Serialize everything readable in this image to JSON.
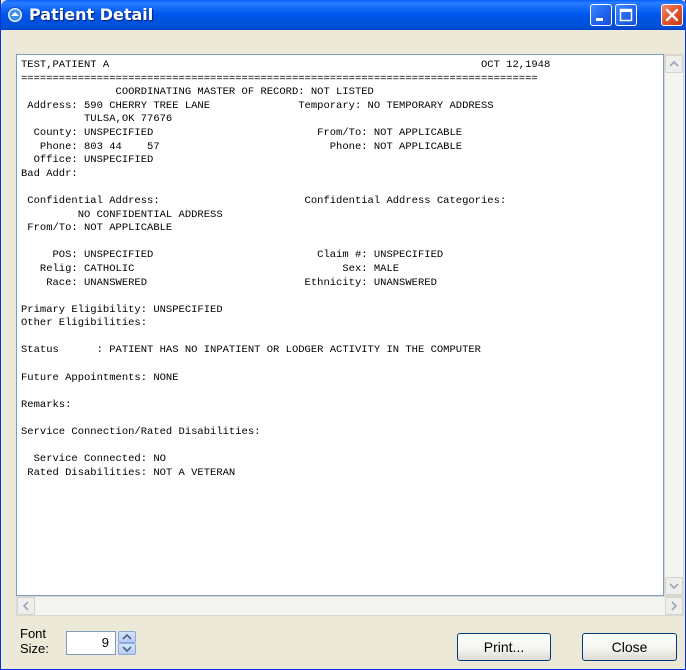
{
  "window": {
    "title": "Patient Detail"
  },
  "report": {
    "lines": [
      "TEST,PATIENT A                                                           OCT 12,1948",
      "==================================================================================",
      "               COORDINATING MASTER OF RECORD: NOT LISTED",
      " Address: 590 CHERRY TREE LANE              Temporary: NO TEMPORARY ADDRESS",
      "          TULSA,OK 77676",
      "  County: UNSPECIFIED                          From/To: NOT APPLICABLE",
      "   Phone: 803 44    57                           Phone: NOT APPLICABLE",
      "  Office: UNSPECIFIED",
      "Bad Addr:",
      "",
      " Confidential Address:                       Confidential Address Categories:",
      "         NO CONFIDENTIAL ADDRESS",
      " From/To: NOT APPLICABLE",
      "",
      "     POS: UNSPECIFIED                          Claim #: UNSPECIFIED",
      "   Relig: CATHOLIC                                 Sex: MALE",
      "    Race: UNANSWERED                         Ethnicity: UNANSWERED",
      "",
      "Primary Eligibility: UNSPECIFIED",
      "Other Eligibilities:",
      "",
      "Status      : PATIENT HAS NO INPATIENT OR LODGER ACTIVITY IN THE COMPUTER",
      "",
      "Future Appointments: NONE",
      "",
      "Remarks:",
      "",
      "Service Connection/Rated Disabilities:",
      "",
      "  Service Connected: NO",
      " Rated Disabilities: NOT A VETERAN"
    ]
  },
  "controls": {
    "font_size_label": "Font\nSize:",
    "font_size_value": "9",
    "print_label": "Print...",
    "close_label": "Close"
  },
  "icons": {
    "title": "window-app-icon",
    "minimize": "minimize-icon",
    "maximize": "maximize-icon",
    "close": "close-icon",
    "spin_up": "spin-up-icon",
    "spin_down": "spin-down-icon"
  },
  "colors": {
    "titlebar": "#0054e3",
    "close_button": "#e2532d",
    "window_face": "#ece9d8"
  }
}
